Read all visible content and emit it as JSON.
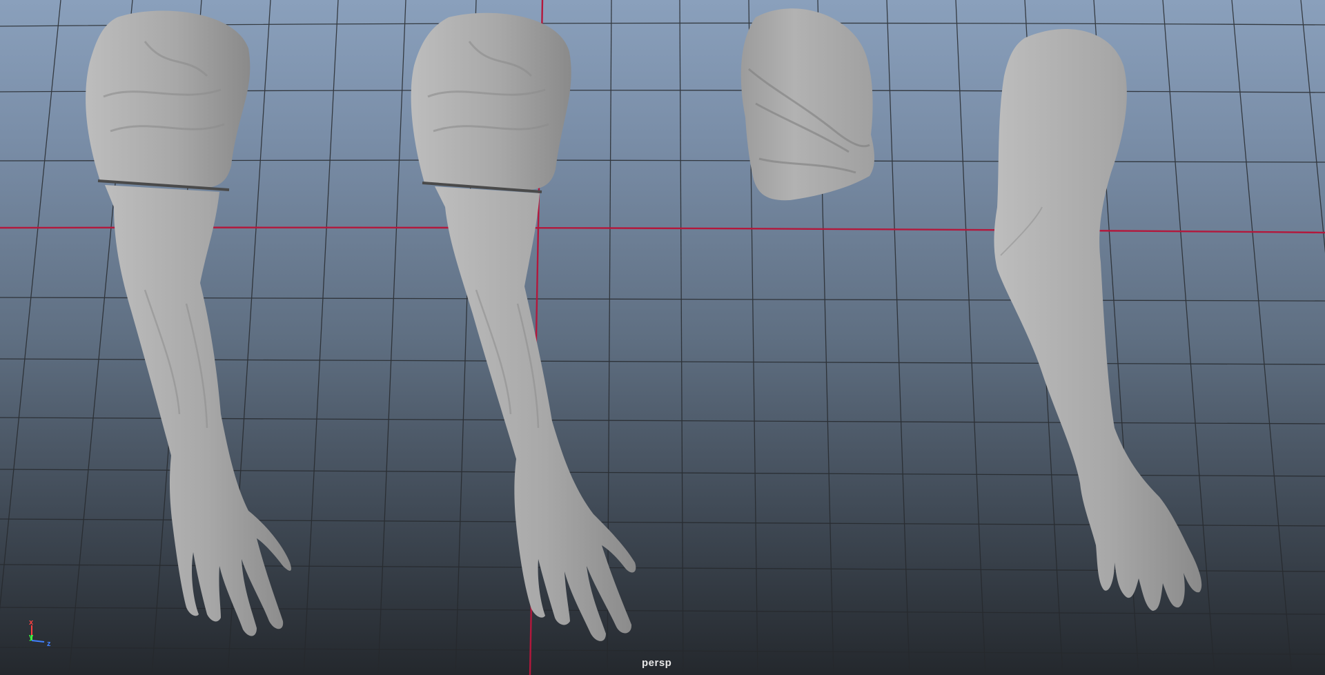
{
  "viewport": {
    "camera_label": "persp",
    "axes": {
      "x": "x",
      "y": "y",
      "z": "z"
    },
    "colors": {
      "grid": "#26292d",
      "grid_axis": "#b3183c",
      "mesh": "#a6a6a6",
      "label": "#e8e8e8"
    }
  },
  "objects": [
    {
      "name": "arm-with-sleeve-left"
    },
    {
      "name": "arm-with-sleeve-center"
    },
    {
      "name": "sleeve-cap"
    },
    {
      "name": "bare-arm-right"
    }
  ]
}
